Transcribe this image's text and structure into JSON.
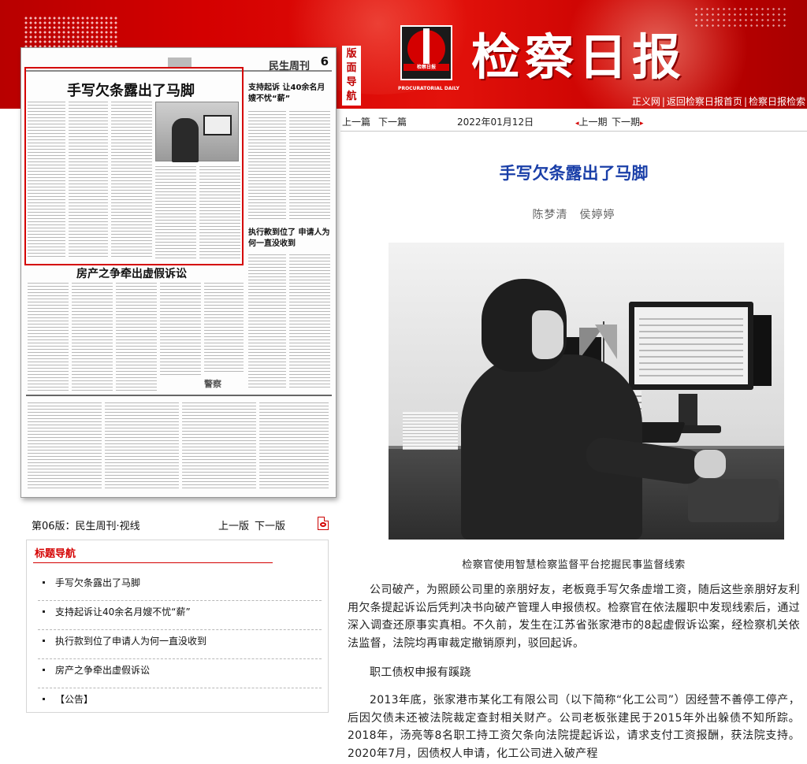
{
  "header": {
    "paper_title": "检察日报",
    "logo_caption": "检察日报",
    "logo_en": "PROCURATORIAL DAILY",
    "side_nav": "版面导航",
    "links": [
      "正义网",
      "返回检察日报首页",
      "检察日报检索"
    ]
  },
  "thumbnail": {
    "page_number": "6",
    "section": "民生周刊",
    "headline_main": "手写欠条露出了马脚",
    "headline_right_1": "支持起诉 让40余名月嫂不忧“薪”",
    "headline_right_2": "执行款到位了 申请人为何一直没收到",
    "headline_bottom": "房产之争牵出虚假诉讼",
    "logo_small": "警察"
  },
  "edition": {
    "label": "第06版：民生周刊·视线",
    "prev": "上一版",
    "next": "下一版"
  },
  "title_nav": {
    "heading": "标题导航",
    "items": [
      "手写欠条露出了马脚",
      "支持起诉让40余名月嫂不忧“薪”",
      "执行款到位了申请人为何一直没收到",
      "房产之争牵出虚假诉讼",
      "【公告】"
    ]
  },
  "article_nav": {
    "prev_article": "上一篇",
    "next_article": "下一篇",
    "date": "2022年01月12日",
    "prev_issue": "上一期",
    "next_issue": "下一期"
  },
  "article": {
    "title": "手写欠条露出了马脚",
    "authors": "陈梦清　侯婷婷",
    "photo_caption": "检察官使用智慧检察监督平台挖掘民事监督线索",
    "paragraphs": [
      "公司破产，为照顾公司里的亲朋好友，老板竟手写欠条虚增工资，随后这些亲朋好友利用欠条提起诉讼后凭判决书向破产管理人申报债权。检察官在依法履职中发现线索后，通过深入调查还原事实真相。不久前，发生在江苏省张家港市的8起虚假诉讼案，经检察机关依法监督，法院均再审裁定撤销原判，驳回起诉。",
      "职工债权申报有蹊跷",
      "2013年底，张家港市某化工有限公司（以下简称“化工公司”）因经营不善停工停产，后因欠债未还被法院裁定查封相关财产。公司老板张建民于2015年外出躲债不知所踪。2018年，汤亮等8名职工持工资欠条向法院提起诉讼，请求支付工资报酬，获法院支持。2020年7月，因债权人申请，化工公司进入破产程"
    ]
  },
  "colors": {
    "brand_red": "#d40000",
    "title_blue": "#1a3fa8"
  }
}
